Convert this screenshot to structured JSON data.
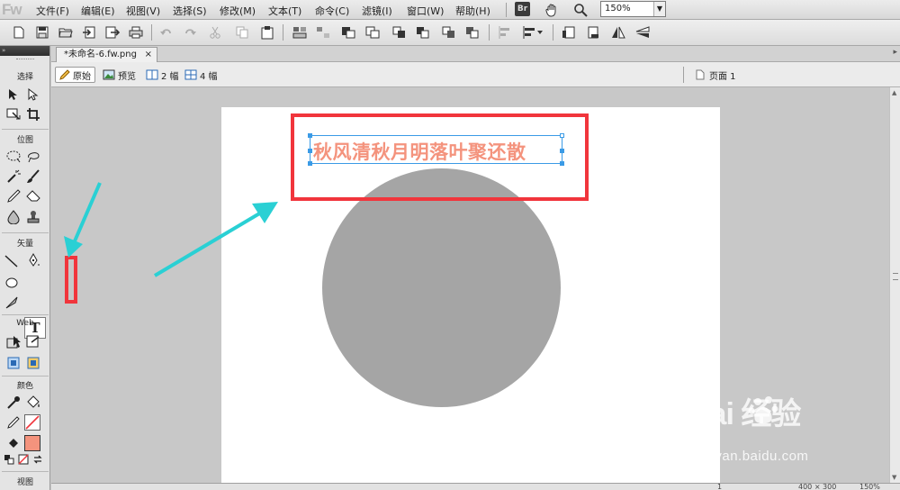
{
  "app": {
    "logo": "Fw"
  },
  "menu": {
    "items": [
      "文件(F)",
      "编辑(E)",
      "视图(V)",
      "选择(S)",
      "修改(M)",
      "文本(T)",
      "命令(C)",
      "滤镜(I)",
      "窗口(W)",
      "帮助(H)"
    ],
    "bridge_label": "Br",
    "zoom": "150%"
  },
  "toolbar": {
    "icons": [
      "new-document-icon",
      "save-icon",
      "open-icon",
      "import-icon",
      "export-icon",
      "print-icon",
      "undo-icon",
      "redo-icon",
      "cut-icon",
      "copy-icon",
      "paste-icon",
      "group-icon",
      "ungroup-icon",
      "join-icon",
      "split-icon",
      "bring-to-front-icon",
      "bring-forward-icon",
      "send-backward-icon",
      "send-to-back-icon",
      "align-menu-icon",
      "rotate-90-ccw-icon",
      "rotate-90-cw-icon",
      "flip-horizontal-icon",
      "flip-vertical-icon"
    ]
  },
  "tools": {
    "panel_header": "»",
    "sections": {
      "select": "选择",
      "bitmap": "位图",
      "vector": "矢量",
      "web": "Web",
      "colors": "颜色",
      "view": "视图"
    },
    "selected_tool_glyph": "T",
    "selected_tool": "text-tool",
    "fill_color": "#f4937d",
    "stroke_color": "#f1353c"
  },
  "document": {
    "tab_title": "*未命名-6.fw.png",
    "tab_close": "×"
  },
  "viewbar": {
    "original": "原始",
    "preview": "预览",
    "two_up": "2 幅",
    "four_up": "4 幅",
    "page": "页面 1"
  },
  "canvas": {
    "text": "秋风清秋月明落叶聚还散",
    "text_color": "#f4937d",
    "circle_color": "#a5a5a5"
  },
  "annotations": {
    "box_color": "#f1353c",
    "arrow_color": "#2ad0d4"
  },
  "statusbar": {
    "page_number": "1",
    "canvas_size": "400 × 300",
    "zoom": "150%"
  },
  "watermark": {
    "logo": "Bai  经验",
    "url": "jingyan.baidu.com"
  }
}
